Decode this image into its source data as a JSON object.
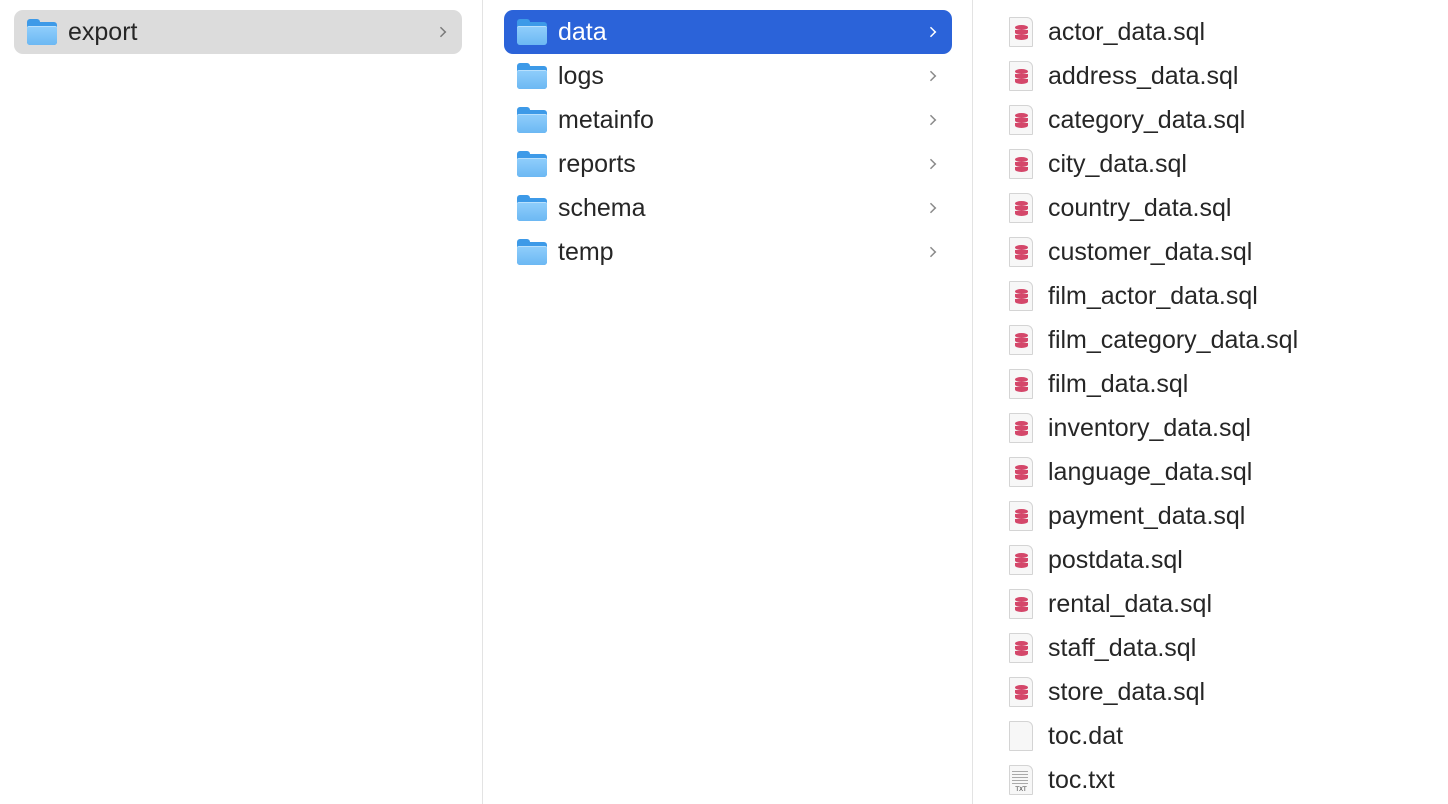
{
  "column1": {
    "items": [
      {
        "label": "export",
        "icon": "folder-icon",
        "state": "selected-inactive"
      }
    ]
  },
  "column2": {
    "items": [
      {
        "label": "data",
        "icon": "folder-icon",
        "state": "selected-active"
      },
      {
        "label": "logs",
        "icon": "folder-icon",
        "state": "normal"
      },
      {
        "label": "metainfo",
        "icon": "folder-icon",
        "state": "normal"
      },
      {
        "label": "reports",
        "icon": "folder-icon",
        "state": "normal"
      },
      {
        "label": "schema",
        "icon": "folder-icon",
        "state": "normal"
      },
      {
        "label": "temp",
        "icon": "folder-icon",
        "state": "normal"
      }
    ]
  },
  "column3": {
    "items": [
      {
        "label": "actor_data.sql",
        "icon": "sql-file-icon"
      },
      {
        "label": "address_data.sql",
        "icon": "sql-file-icon"
      },
      {
        "label": "category_data.sql",
        "icon": "sql-file-icon"
      },
      {
        "label": "city_data.sql",
        "icon": "sql-file-icon"
      },
      {
        "label": "country_data.sql",
        "icon": "sql-file-icon"
      },
      {
        "label": "customer_data.sql",
        "icon": "sql-file-icon"
      },
      {
        "label": "film_actor_data.sql",
        "icon": "sql-file-icon"
      },
      {
        "label": "film_category_data.sql",
        "icon": "sql-file-icon"
      },
      {
        "label": "film_data.sql",
        "icon": "sql-file-icon"
      },
      {
        "label": "inventory_data.sql",
        "icon": "sql-file-icon"
      },
      {
        "label": "language_data.sql",
        "icon": "sql-file-icon"
      },
      {
        "label": "payment_data.sql",
        "icon": "sql-file-icon"
      },
      {
        "label": "postdata.sql",
        "icon": "sql-file-icon"
      },
      {
        "label": "rental_data.sql",
        "icon": "sql-file-icon"
      },
      {
        "label": "staff_data.sql",
        "icon": "sql-file-icon"
      },
      {
        "label": "store_data.sql",
        "icon": "sql-file-icon"
      },
      {
        "label": "toc.dat",
        "icon": "blank-file-icon"
      },
      {
        "label": "toc.txt",
        "icon": "text-file-icon",
        "badge": "TXT"
      }
    ]
  },
  "colors": {
    "selected_active": "#2b63d9",
    "selected_inactive": "#dcdcdc",
    "folder": "#6cb8f3",
    "sql_mark": "#d4476a"
  }
}
